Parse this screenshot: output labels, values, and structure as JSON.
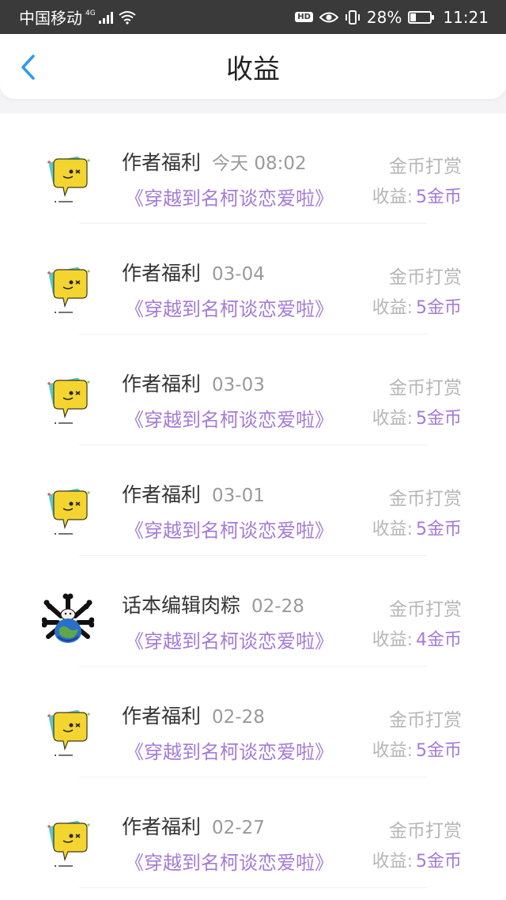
{
  "status_bar": {
    "carrier": "中国移动",
    "network": "4G",
    "battery": "28%",
    "battery_level": 0.28,
    "time": "11:21",
    "hd_badge": "HD"
  },
  "header": {
    "title": "收益",
    "back_icon": "chevron-left-icon",
    "accent_color": "#2f9bea"
  },
  "earnings": [
    {
      "name": "作者福利",
      "time": "今天 08:02",
      "tag": "金币打赏",
      "book": "《穿越到名柯谈恋爱啦》",
      "earn_label": "收益:",
      "earn_value": "5金币",
      "avatar": "yellow-chat-emoji"
    },
    {
      "name": "作者福利",
      "time": "03-04",
      "tag": "金币打赏",
      "book": "《穿越到名柯谈恋爱啦》",
      "earn_label": "收益:",
      "earn_value": "5金币",
      "avatar": "yellow-chat-emoji"
    },
    {
      "name": "作者福利",
      "time": "03-03",
      "tag": "金币打赏",
      "book": "《穿越到名柯谈恋爱啦》",
      "earn_label": "收益:",
      "earn_value": "5金币",
      "avatar": "yellow-chat-emoji"
    },
    {
      "name": "作者福利",
      "time": "03-01",
      "tag": "金币打赏",
      "book": "《穿越到名柯谈恋爱啦》",
      "earn_label": "收益:",
      "earn_value": "5金币",
      "avatar": "yellow-chat-emoji"
    },
    {
      "name": "话本编辑肉粽",
      "time": "02-28",
      "tag": "金币打赏",
      "book": "《穿越到名柯谈恋爱啦》",
      "earn_label": "收益:",
      "earn_value": "4金币",
      "avatar": "globe-bones-avatar"
    },
    {
      "name": "作者福利",
      "time": "02-28",
      "tag": "金币打赏",
      "book": "《穿越到名柯谈恋爱啦》",
      "earn_label": "收益:",
      "earn_value": "5金币",
      "avatar": "yellow-chat-emoji"
    },
    {
      "name": "作者福利",
      "time": "02-27",
      "tag": "金币打赏",
      "book": "《穿越到名柯谈恋爱啦》",
      "earn_label": "收益:",
      "earn_value": "5金币",
      "avatar": "yellow-chat-emoji"
    }
  ],
  "colors": {
    "purple": "#a47bd6",
    "muted": "#b6b6b6",
    "name": "#333333"
  }
}
